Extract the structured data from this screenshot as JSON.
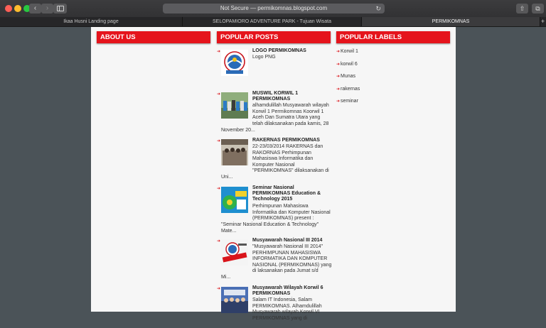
{
  "browser": {
    "url_text": "Not Secure — permikomnas.blogspot.com",
    "tabs": [
      {
        "label": "Ikaa Husni Landing page"
      },
      {
        "label": "SELOPAMIORO ADVENTURE PARK - Tujuan Wisata"
      },
      {
        "label": "PERMIKOMNAS"
      }
    ],
    "icons": {
      "back": "‹",
      "forward": "›",
      "reload": "↻",
      "share": "⇧",
      "tabs": "⧉",
      "new_tab": "+"
    }
  },
  "about": {
    "heading": "ABOUT US"
  },
  "popular_posts": {
    "heading": "POPULAR POSTS",
    "items": [
      {
        "title": "LOGO PERMIKOMNAS",
        "desc": "Logo PNG"
      },
      {
        "title": "MUSWIL KORWIL 1 PERMIKOMNAS",
        "desc": "alhamdulillah Musyawarah wilayah Korwil 1 Permikomnas Koorwil 1 Aceh Dan Sumatra Utara yang telah dilaksanakan pada kamis, 28",
        "tail": "November 20..."
      },
      {
        "title": "RAKERNAS PERMIKOMNAS",
        "desc": "22-23/03/2014 RAKERNAS dan RAKORNAS Perhimpunan Mahasiswa Informatika dan Komputer Nasional \"PERMIKOMNAS\" dilaksanakan di",
        "tail": "Uni..."
      },
      {
        "title": "Seminar Nasional PERMIKOMNAS Education & Technology 2015",
        "desc": "Perhimpunan Mahasiswa Informatika dan Komputer Nasional (PERMIKOMNAS) present :",
        "tail": "\"Seminar Nasional Education & Technology\" Mate..."
      },
      {
        "title": "Musyawarah Nasional III 2014",
        "desc": "\"Musyawarah Nasional III 2014\" PERHIMPUNAN MAHASISWA INFORMATIKA DAN KOMPUTER NASIONAL (PERMIKOMNAS) yang di laksanakan pada Jumat s/d",
        "tail": "Mi..."
      },
      {
        "title": "Musyawarah Wilayah Korwil 6 PERMIKOMNAS",
        "desc": "Salam IT Indonesia, Salam PERMIKOMNAS. Alhamdulillah Musyawarah wilayah Korwil VI PERMIKOMNAS yang di"
      }
    ]
  },
  "popular_labels": {
    "heading": "POPULAR LABELS",
    "items": [
      "Korwil 1",
      "korwil 6",
      "Munas",
      "rakernas",
      "seminar"
    ]
  },
  "colors": {
    "accent": "#e5141c",
    "page_bg": "#f6f6f6",
    "desktop_bg": "#4b5358"
  }
}
